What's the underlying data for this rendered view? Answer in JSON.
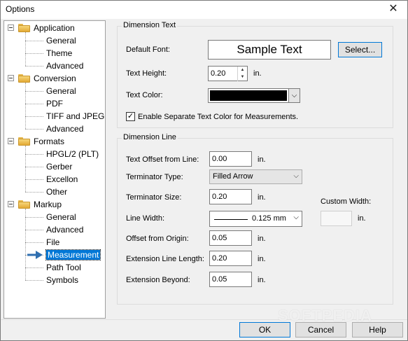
{
  "window": {
    "title": "Options",
    "close_glyph": "✕"
  },
  "tree": {
    "groups": [
      {
        "label": "Application",
        "children": [
          "General",
          "Theme",
          "Advanced"
        ]
      },
      {
        "label": "Conversion",
        "children": [
          "General",
          "PDF",
          "TIFF and JPEG",
          "Advanced"
        ]
      },
      {
        "label": "Formats",
        "children": [
          "HPGL/2 (PLT)",
          "Gerber",
          "Excellon",
          "Other"
        ]
      },
      {
        "label": "Markup",
        "children": [
          "General",
          "Advanced",
          "File",
          "Measurement",
          "Path Tool",
          "Symbols"
        ]
      }
    ],
    "selected": "Measurement"
  },
  "dimension_text": {
    "group_label": "Dimension Text",
    "default_font_label": "Default Font:",
    "sample_text": "Sample Text",
    "select_button": "Select...",
    "text_height_label": "Text Height:",
    "text_height_value": "0.20",
    "text_height_unit": "in.",
    "text_color_label": "Text Color:",
    "text_color_value": "#000000",
    "separate_color_label": "Enable Separate Text Color for Measurements.",
    "separate_color_checked": true
  },
  "dimension_line": {
    "group_label": "Dimension Line",
    "offset_line_label": "Text Offset from Line:",
    "offset_line_value": "0.00",
    "terminator_type_label": "Terminator Type:",
    "terminator_type_value": "Filled Arrow",
    "terminator_size_label": "Terminator Size:",
    "terminator_size_value": "0.20",
    "line_width_label": "Line Width:",
    "line_width_value": "0.125 mm",
    "offset_origin_label": "Offset from Origin:",
    "offset_origin_value": "0.05",
    "extension_length_label": "Extension Line Length:",
    "extension_length_value": "0.20",
    "extension_beyond_label": "Extension Beyond:",
    "extension_beyond_value": "0.05",
    "custom_width_label": "Custom Width:",
    "custom_width_value": "",
    "unit": "in."
  },
  "buttons": {
    "ok": "OK",
    "cancel": "Cancel",
    "help": "Help"
  },
  "watermark": "SOFTPEDIA"
}
